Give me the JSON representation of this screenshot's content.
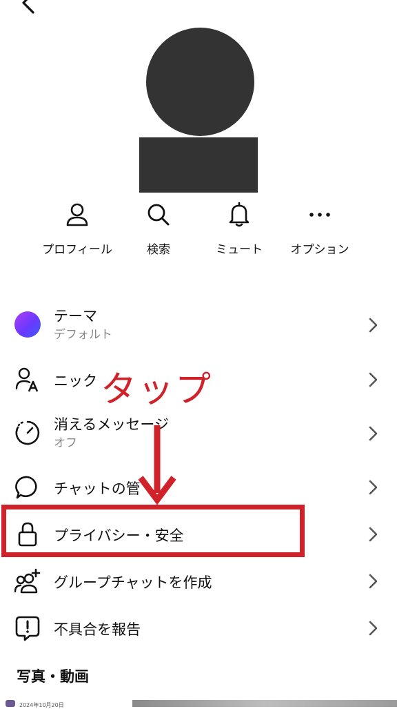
{
  "header": {
    "back_icon": "chevron-left-icon"
  },
  "actions": [
    {
      "label": "プロフィール",
      "icon": "person-icon"
    },
    {
      "label": "検索",
      "icon": "search-icon"
    },
    {
      "label": "ミュート",
      "icon": "bell-icon"
    },
    {
      "label": "オプション",
      "icon": "more-dots-icon"
    }
  ],
  "menu": {
    "theme": {
      "title": "テーマ",
      "sub": "デフォルト"
    },
    "nickname": {
      "title": "ニック"
    },
    "disappearing": {
      "title": "消えるメッセージ",
      "sub": "オフ"
    },
    "chat_manage": {
      "title": "チャットの管"
    },
    "privacy": {
      "title": "プライバシー・安全"
    },
    "group": {
      "title": "グループチャットを作成"
    },
    "report": {
      "title": "不具合を報告"
    }
  },
  "annotation": {
    "tap_label": "タップ",
    "color": "#d0222a"
  },
  "media": {
    "section_title": "写真・動画",
    "date": "2024年10月20日"
  }
}
